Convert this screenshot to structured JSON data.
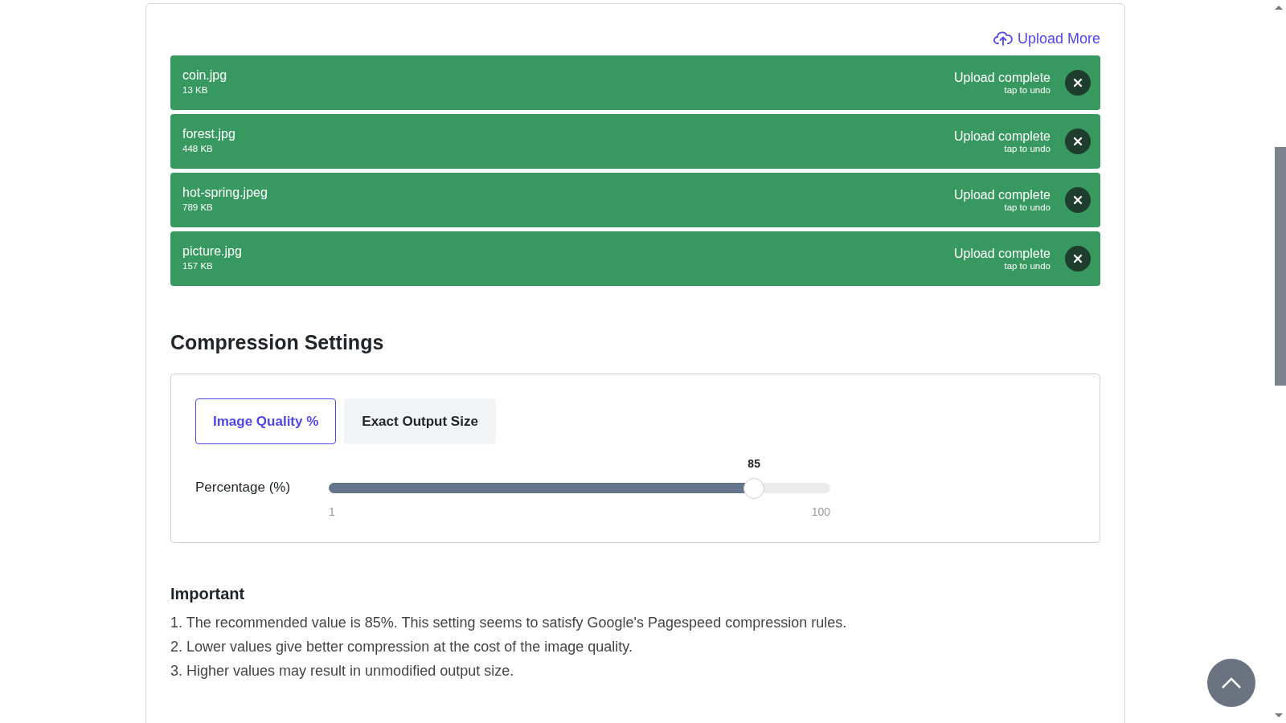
{
  "upload_more": {
    "label": "Upload More"
  },
  "files": [
    {
      "name": "coin.jpg",
      "size": "13 KB",
      "status": "Upload complete",
      "hint": "tap to undo"
    },
    {
      "name": "forest.jpg",
      "size": "448 KB",
      "status": "Upload complete",
      "hint": "tap to undo"
    },
    {
      "name": "hot-spring.jpeg",
      "size": "789 KB",
      "status": "Upload complete",
      "hint": "tap to undo"
    },
    {
      "name": "picture.jpg",
      "size": "157 KB",
      "status": "Upload complete",
      "hint": "tap to undo"
    }
  ],
  "settings": {
    "title": "Compression Settings",
    "tabs": [
      {
        "label": "Image Quality %",
        "selected": true
      },
      {
        "label": "Exact Output Size",
        "selected": false
      }
    ],
    "slider": {
      "label": "Percentage (%)",
      "value": "85",
      "level": 0.848,
      "min": "1",
      "max": "100"
    }
  },
  "important": {
    "title": "Important",
    "items": [
      "1. The recommended value is 85%. This setting seems to satisfy Google's Pagespeed compression rules.",
      "2. Lower values give better compression at the cost of the image quality.",
      "3. Higher values may result in unmodified output size."
    ]
  }
}
